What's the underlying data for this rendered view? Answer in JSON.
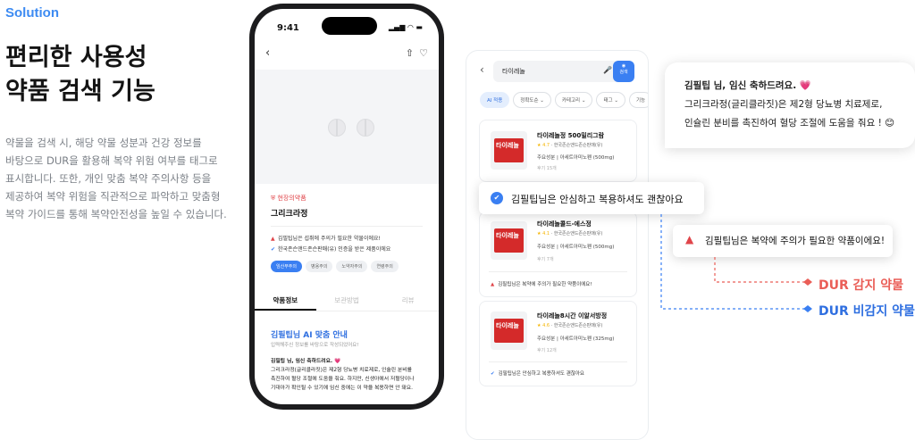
{
  "section_label": "Solution",
  "headline": {
    "line1": "편리한 사용성",
    "line2": "약품 검색 기능"
  },
  "description": [
    "약물을 검색 시, 해당 약물 성분과 건강 정보를",
    "바탕으로 DUR을 활용해 복약 위험 여부를 태그로",
    "표시합니다. 또한, 개인 맞춤 복약 주의사항 등을",
    "제공하여 복약 위험을 직관적으로 파악하고 맞춤형",
    "복약 가이드를 통해 복약안전성을 높일 수 있습니다."
  ],
  "phone": {
    "status_time": "9:41",
    "status_icons": "▂▄▆ ◠ ▬",
    "nav": {
      "back": "‹",
      "share": "⇧",
      "heart": "♡"
    },
    "warning_tag": "현장의약품",
    "drug_name": "그리크라정",
    "status_lines": [
      {
        "icon": "▲",
        "text": "김필팁님은 섭취에 주의가 필요한 약물이에요!"
      },
      {
        "icon": "✔",
        "text": "한국존슨앤드존슨판매(유) 인증을 받은 제품이에요"
      }
    ],
    "chips": [
      "임산부주의",
      "병용주의",
      "노약자주의",
      "연령주의"
    ],
    "tabs": [
      "약품정보",
      "보관방법",
      "리뷰"
    ],
    "ai_title": "김필팁님 AI 맞춤 안내",
    "ai_subtitle": "입력해주신 정보를 바탕으로 작성되었어요!",
    "ai_body": [
      "김필팁 님, 임신 축하드려요. 💗",
      "그리크라정(글리클라짓)은 제2형 당뇨병 치료제로, 인슐린 분비를",
      "촉진하여 혈당 조절에 도움을 줘요. 하지만, 신생아에서 저혈당이나",
      "기대아가 확인될 수 있기에 임신 중에는 이 약을 복용하면 안 돼요."
    ]
  },
  "search": {
    "back": "‹",
    "query": "타이레놀",
    "mic": "🎤",
    "camera_label": "검색",
    "filters": [
      "AI 적용",
      "정확도순 ⌄",
      "카테고리 ⌄",
      "태그 ⌄",
      "기능"
    ],
    "results": [
      {
        "box": "타이레놀",
        "name": "타이레놀정 500밀리그람",
        "rating": "★ 4.7",
        "maker": "한국존슨앤드존슨판매(유)",
        "main": "주요성분 | 아세트아미노펜 (500mg)",
        "reviews": "후기 15개",
        "note_icon": "✔",
        "note": "김필팁님은 안심하고 복용하셔도 괜찮아요"
      },
      {
        "box": "타이레놀",
        "name": "타이레놀콜드-에스정",
        "rating": "★ 4.1",
        "maker": "한국존슨앤드존슨판매(유)",
        "main": "주요성분 | 아세트아미노펜 (500mg)",
        "reviews": "후기 7개",
        "note_icon": "▲",
        "note": "김필팁님은 복약에 주의가 필요한 약품이에요!"
      },
      {
        "box": "타이레놀",
        "name": "타이레놀8시간 이알서방정",
        "rating": "★ 4.6",
        "maker": "한국존슨앤드존슨판매(유)",
        "main": "주요성분 | 아세트아미노펜 (325mg)",
        "reviews": "후기 12개",
        "note_icon": "✔",
        "note": "김필팁님은 안심하고 복용하셔도 괜찮아요"
      }
    ]
  },
  "popups": {
    "safe_text": "김필팁님은 안심하고 복용하셔도 괜찮아요",
    "bubble": [
      "김필팁 님, 임신 축하드려요. 💗",
      "그리크라정(글리클라짓)은 제2형 당뇨병 치료제로,",
      "인슐린 분비를 촉진하여 혈당 조절에 도움을 줘요 ! 😊"
    ],
    "warn_text": "김필팁님은 복약에 주의가 필요한 약품이에요!"
  },
  "labels": {
    "detected": "DUR 감지 약물",
    "undetected": "DUR 비감지 약물"
  },
  "colors": {
    "accent_blue": "#3a7ff2",
    "warn_red": "#ea5e57",
    "highlight_yellow": "#fbe85a"
  }
}
